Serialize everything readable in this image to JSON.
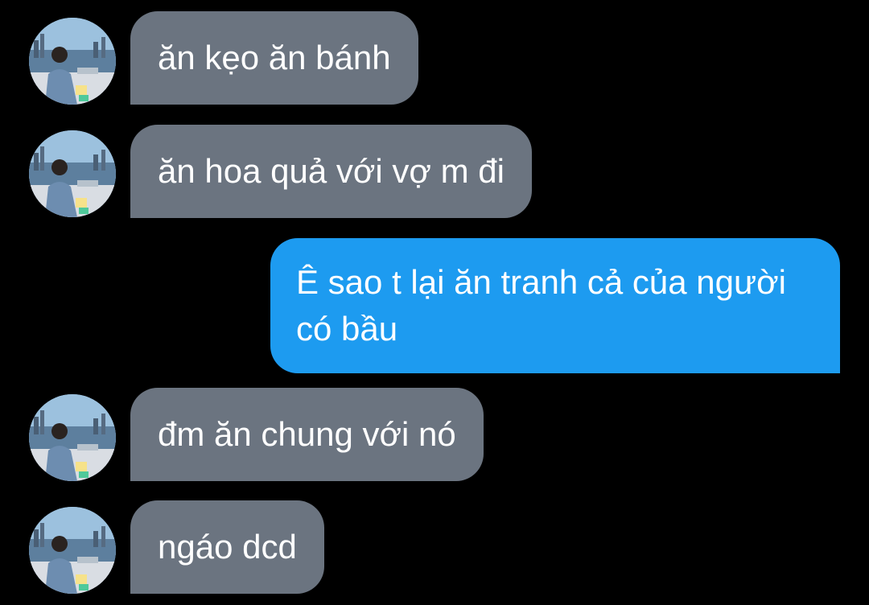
{
  "conversation": {
    "messages": [
      {
        "direction": "incoming",
        "text": "ăn kẹo ăn bánh",
        "has_avatar": true
      },
      {
        "direction": "incoming",
        "text": "ăn hoa quả với vợ m đi",
        "has_avatar": true
      },
      {
        "direction": "outgoing",
        "text": "Ê sao t lại ăn tranh cả của người có bầu",
        "has_avatar": false
      },
      {
        "direction": "incoming",
        "text": "đm ăn chung với nó",
        "has_avatar": true
      },
      {
        "direction": "incoming",
        "text": "ngáo dcd",
        "has_avatar": true
      }
    ]
  },
  "colors": {
    "background": "#000000",
    "incoming_bubble": "#6b7480",
    "outgoing_bubble": "#1d9bf0",
    "text": "#ffffff"
  },
  "icons": {
    "avatar": "contact-avatar-photo"
  }
}
